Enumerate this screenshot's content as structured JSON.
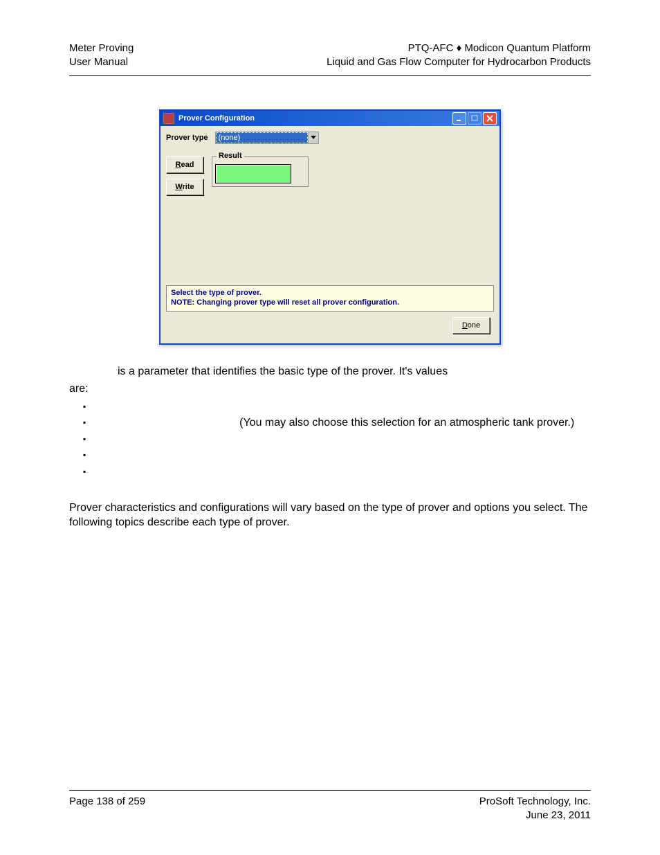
{
  "header": {
    "left_line1": "Meter Proving",
    "left_line2": "User Manual",
    "right_line1": "PTQ-AFC ♦ Modicon Quantum Platform",
    "right_line2": "Liquid and Gas Flow Computer for Hydrocarbon Products"
  },
  "window": {
    "title": "Prover Configuration",
    "prover_type_label": "Prover type",
    "prover_type_value": "(none)",
    "buttons": {
      "read": "Read",
      "write": "Write",
      "done": "Done"
    },
    "result_label": "Result",
    "hint_line1": "Select the type of prover.",
    "hint_line2": "NOTE: Changing prover type will reset all prover configuration."
  },
  "body": {
    "intro": "is a parameter that identifies the basic type of the prover. It's values",
    "intro2": "are:",
    "li1_tail": "(You may also choose this selection for an atmospheric tank prover.)",
    "closing": "Prover characteristics and configurations  will vary based on the type of prover and options you select. The following topics describe each type of prover."
  },
  "footer": {
    "left": "Page 138 of 259",
    "right_line1": "ProSoft Technology, Inc.",
    "right_line2": "June 23, 2011"
  }
}
